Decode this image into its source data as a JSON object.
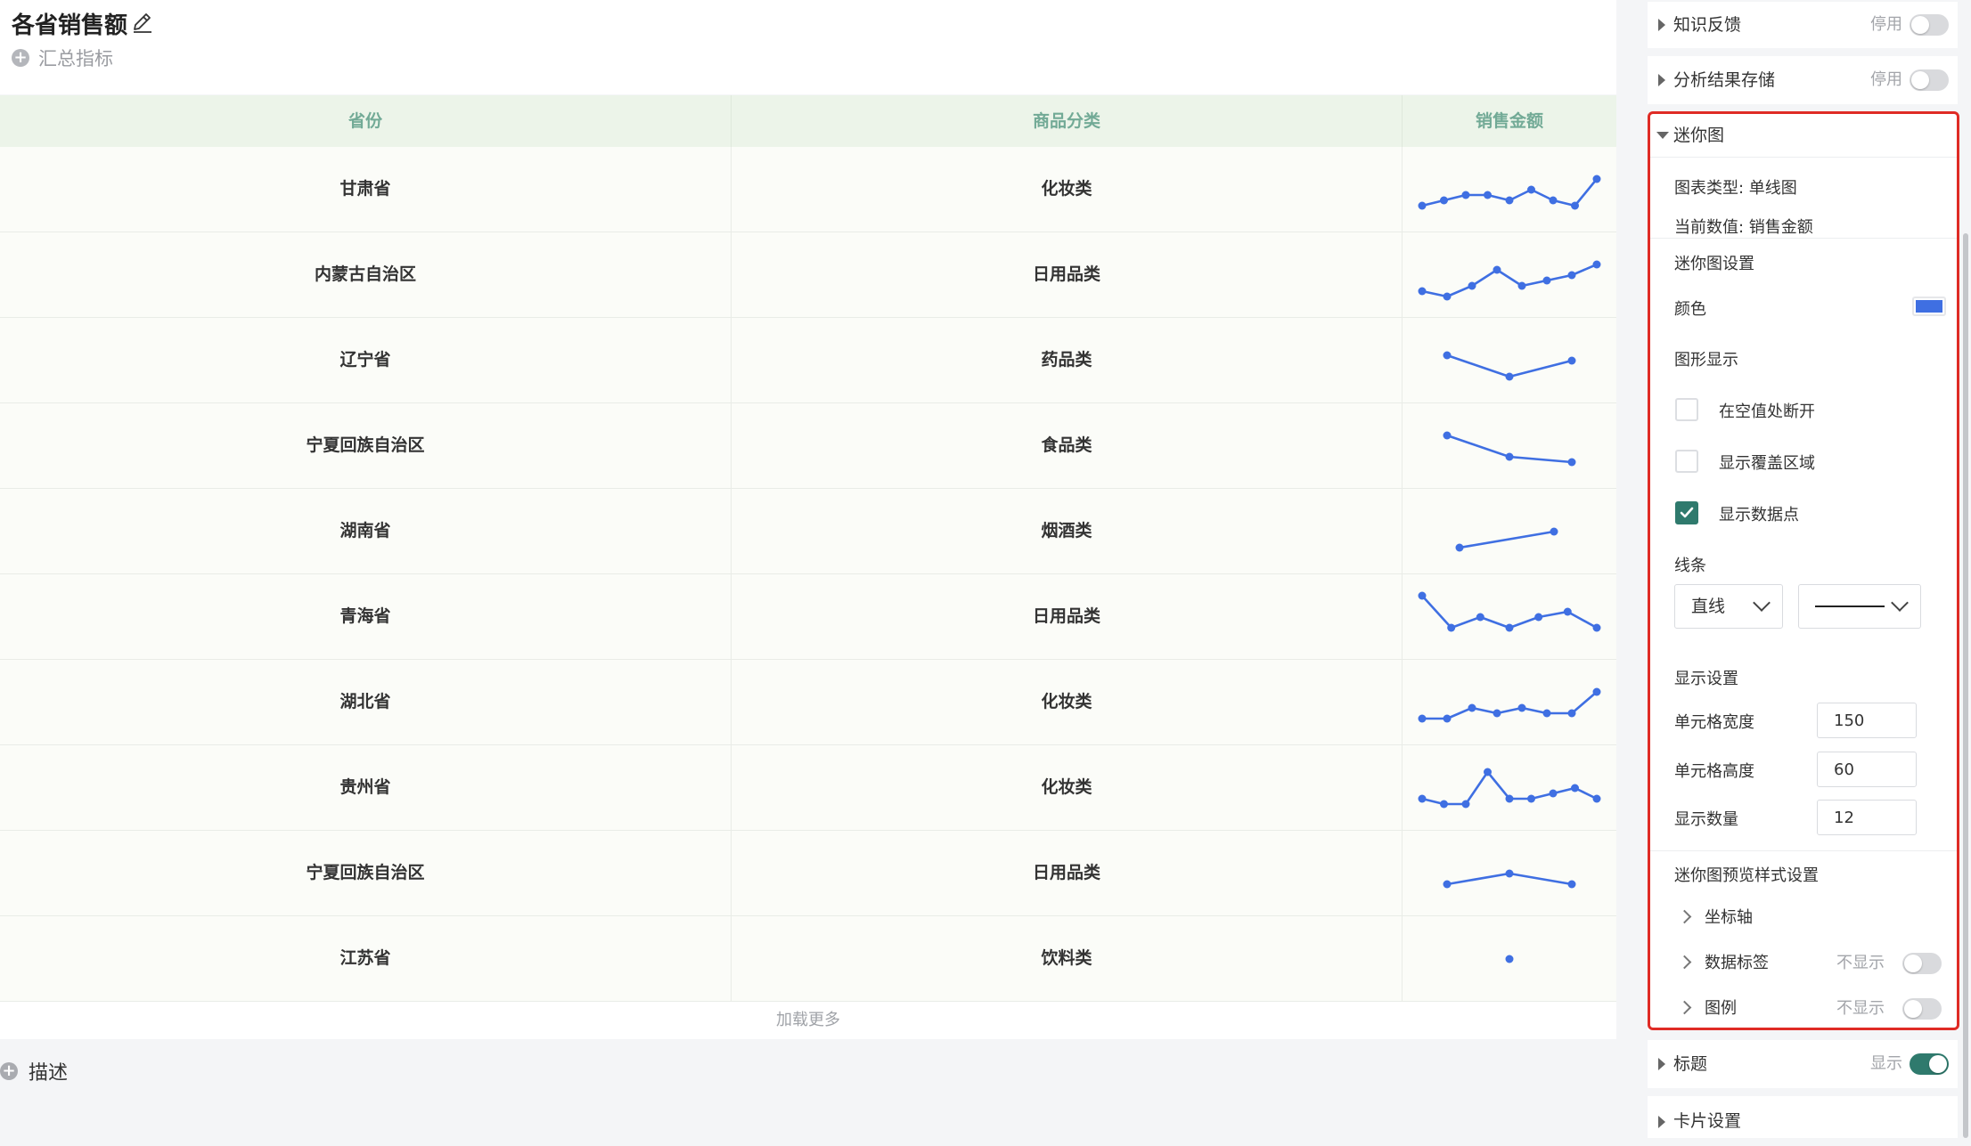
{
  "header": {
    "title": "各省销售额",
    "summary_label": "汇总指标"
  },
  "table": {
    "columns": [
      "省份",
      "商品分类",
      "销售金额"
    ],
    "rows": [
      {
        "province": "甘肃省",
        "category": "化妆类",
        "spark": [
          2,
          3,
          4,
          4,
          3,
          5,
          3,
          2,
          7
        ]
      },
      {
        "province": "内蒙古自治区",
        "category": "日用品类",
        "spark": [
          2,
          1,
          3,
          6,
          3,
          4,
          5,
          7
        ]
      },
      {
        "province": "辽宁省",
        "category": "药品类",
        "spark": [
          6,
          2,
          5
        ]
      },
      {
        "province": "宁夏回族自治区",
        "category": "食品类",
        "spark": [
          7,
          3,
          2
        ]
      },
      {
        "province": "湖南省",
        "category": "烟酒类",
        "spark": [
          2,
          5
        ]
      },
      {
        "province": "青海省",
        "category": "日用品类",
        "spark": [
          9,
          3,
          5,
          3,
          5,
          6,
          3
        ]
      },
      {
        "province": "湖北省",
        "category": "化妆类",
        "spark": [
          2,
          2,
          4,
          3,
          4,
          3,
          3,
          7
        ]
      },
      {
        "province": "贵州省",
        "category": "化妆类",
        "spark": [
          3,
          2,
          2,
          8,
          3,
          3,
          4,
          5,
          3
        ]
      },
      {
        "province": "宁夏回族自治区",
        "category": "日用品类",
        "spark": [
          3,
          5,
          3
        ]
      },
      {
        "province": "江苏省",
        "category": "饮料类",
        "spark": [
          5
        ]
      }
    ],
    "load_more": "加载更多"
  },
  "description": {
    "label": "描述"
  },
  "settings": {
    "knowledge_feedback": {
      "label": "知识反馈",
      "status": "停用"
    },
    "analysis_storage": {
      "label": "分析结果存储",
      "status": "停用"
    },
    "mini_chart": {
      "label": "迷你图",
      "chart_type": "图表类型:  单线图",
      "current_value": "当前数值:  销售金额",
      "settings_label": "迷你图设置",
      "color_label": "颜色",
      "color": "#3f6fe2",
      "shape_label": "图形显示",
      "opt_break_null": "在空值处断开",
      "opt_show_area": "显示覆盖区域",
      "opt_show_points": "显示数据点",
      "line_label": "线条",
      "line_type": "直线",
      "display_settings": "显示设置",
      "cell_width_label": "单元格宽度",
      "cell_width": "150",
      "cell_height_label": "单元格高度",
      "cell_height": "60",
      "display_count_label": "显示数量",
      "display_count": "12",
      "preview_style_label": "迷你图预览样式设置",
      "axis_label": "坐标轴",
      "data_label": "数据标签",
      "data_label_status": "不显示",
      "legend_label": "图例",
      "legend_status": "不显示"
    },
    "title_section": {
      "label": "标题",
      "status": "显示"
    },
    "card_settings": {
      "label": "卡片设置"
    }
  }
}
